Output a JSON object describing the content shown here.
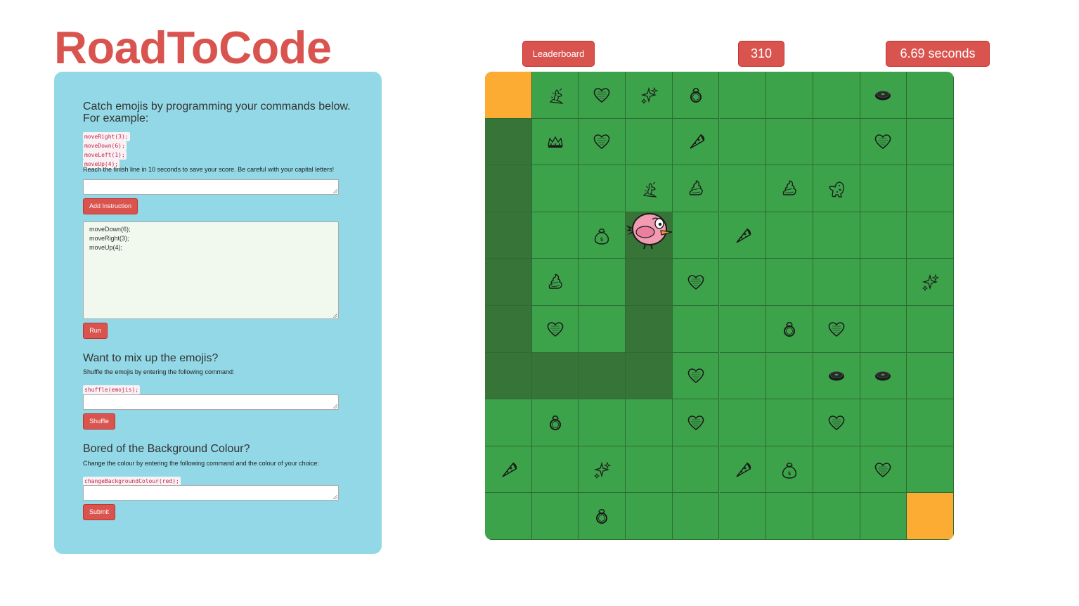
{
  "app": {
    "title": "RoadToCode"
  },
  "intro": {
    "heading": "Catch emojis by programming your commands below. For example:",
    "examples": [
      "moveRight(3);",
      "moveDown(6);",
      "moveLeft(1);",
      "moveUp(4);"
    ],
    "note": "Reach the finish line in 10 seconds to save your score. Be careful with your capital letters!",
    "instruction_input_value": "",
    "add_button": "Add Instruction",
    "program_lines": [
      "moveDown(6);",
      "moveRight(3);",
      "moveUp(4);"
    ],
    "run_button": "Run"
  },
  "shuffle": {
    "heading": "Want to mix up the emojis?",
    "desc": "Shuffle the emojis by entering the following command:",
    "command": "shuffle(emojis);",
    "input_value": "",
    "button": "Shuffle"
  },
  "background": {
    "heading": "Bored of the Background Colour?",
    "desc": "Change the colour by entering the following command and the colour of your choice:",
    "command": "changeBackgroundColour(red);",
    "input_value": "",
    "button": "Submit"
  },
  "header": {
    "leaderboard_button": "Leaderboard",
    "score": "310",
    "timer": "6.69 seconds"
  },
  "colors": {
    "brand_red": "#d9534f",
    "panel_bg": "#92d8e6",
    "board_green": "#3da34a",
    "path_green": "#377438",
    "start_finish": "#fcab33"
  },
  "board": {
    "rows": 10,
    "cols": 10,
    "player_position": {
      "row": 3,
      "col": 3
    },
    "start_cell": {
      "row": 0,
      "col": 0
    },
    "finish_cell": {
      "row": 9,
      "col": 9
    },
    "path_cells": [
      [
        1,
        0
      ],
      [
        2,
        0
      ],
      [
        3,
        0
      ],
      [
        4,
        0
      ],
      [
        5,
        0
      ],
      [
        6,
        0
      ],
      [
        6,
        1
      ],
      [
        6,
        2
      ],
      [
        6,
        3
      ],
      [
        5,
        3
      ],
      [
        4,
        3
      ],
      [
        3,
        3
      ]
    ],
    "emojis": [
      {
        "row": 0,
        "col": 1,
        "icon": "genie"
      },
      {
        "row": 0,
        "col": 2,
        "icon": "heart"
      },
      {
        "row": 0,
        "col": 3,
        "icon": "sparkles"
      },
      {
        "row": 0,
        "col": 4,
        "icon": "ring"
      },
      {
        "row": 0,
        "col": 8,
        "icon": "donut"
      },
      {
        "row": 1,
        "col": 1,
        "icon": "crown"
      },
      {
        "row": 1,
        "col": 2,
        "icon": "heart"
      },
      {
        "row": 1,
        "col": 4,
        "icon": "pizza"
      },
      {
        "row": 1,
        "col": 8,
        "icon": "heart"
      },
      {
        "row": 2,
        "col": 3,
        "icon": "genie"
      },
      {
        "row": 2,
        "col": 4,
        "icon": "poop"
      },
      {
        "row": 2,
        "col": 6,
        "icon": "poop"
      },
      {
        "row": 2,
        "col": 7,
        "icon": "dinosaur"
      },
      {
        "row": 3,
        "col": 2,
        "icon": "money-bag"
      },
      {
        "row": 3,
        "col": 5,
        "icon": "pizza"
      },
      {
        "row": 4,
        "col": 1,
        "icon": "poop"
      },
      {
        "row": 4,
        "col": 4,
        "icon": "heart"
      },
      {
        "row": 4,
        "col": 9,
        "icon": "sparkles"
      },
      {
        "row": 5,
        "col": 1,
        "icon": "heart"
      },
      {
        "row": 5,
        "col": 6,
        "icon": "ring"
      },
      {
        "row": 5,
        "col": 7,
        "icon": "heart"
      },
      {
        "row": 6,
        "col": 4,
        "icon": "heart"
      },
      {
        "row": 6,
        "col": 7,
        "icon": "donut"
      },
      {
        "row": 6,
        "col": 8,
        "icon": "donut"
      },
      {
        "row": 7,
        "col": 1,
        "icon": "ring"
      },
      {
        "row": 7,
        "col": 4,
        "icon": "heart"
      },
      {
        "row": 7,
        "col": 7,
        "icon": "heart"
      },
      {
        "row": 8,
        "col": 0,
        "icon": "pizza"
      },
      {
        "row": 8,
        "col": 2,
        "icon": "sparkles"
      },
      {
        "row": 8,
        "col": 5,
        "icon": "pizza"
      },
      {
        "row": 8,
        "col": 6,
        "icon": "money-bag"
      },
      {
        "row": 8,
        "col": 8,
        "icon": "heart"
      },
      {
        "row": 9,
        "col": 2,
        "icon": "ring"
      }
    ]
  }
}
